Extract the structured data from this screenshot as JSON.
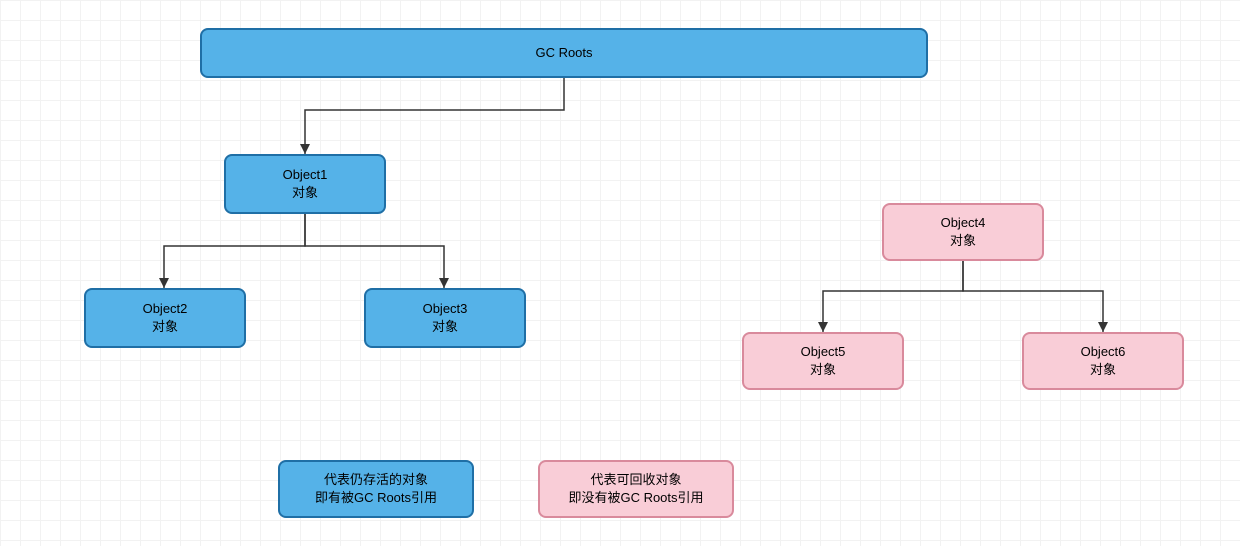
{
  "diagram": {
    "root": {
      "label": "GC Roots"
    },
    "object1": {
      "title": "Object1",
      "subtitle": "对象"
    },
    "object2": {
      "title": "Object2",
      "subtitle": "对象"
    },
    "object3": {
      "title": "Object3",
      "subtitle": "对象"
    },
    "object4": {
      "title": "Object4",
      "subtitle": "对象"
    },
    "object5": {
      "title": "Object5",
      "subtitle": "对象"
    },
    "object6": {
      "title": "Object6",
      "subtitle": "对象"
    },
    "legend_alive": {
      "line1": "代表仍存活的对象",
      "line2": "即有被GC Roots引用"
    },
    "legend_collectable": {
      "line1": "代表可回收对象",
      "line2": "即没有被GC Roots引用"
    }
  },
  "colors": {
    "alive_fill": "#55b2e8",
    "alive_border": "#1f6fa6",
    "collectable_fill": "#f9cdd7",
    "collectable_border": "#d98a9c"
  }
}
